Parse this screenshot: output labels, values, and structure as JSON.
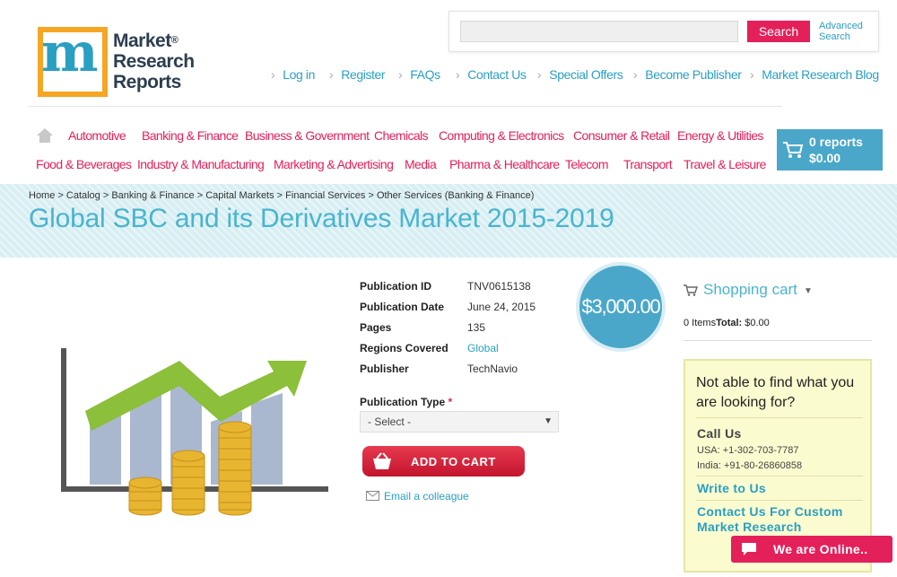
{
  "header": {
    "logo": {
      "line1": "Market",
      "line2": "Research",
      "line3": "Reports",
      "mark": "®"
    },
    "search": {
      "placeholder": "",
      "button_label": "Search",
      "advanced_line1": "Advanced",
      "advanced_line2": "Search"
    },
    "top_links": [
      "Log in",
      "Register",
      "FAQs",
      "Contact Us",
      "Special Offers",
      "Become Publisher",
      "Market Research Blog"
    ]
  },
  "nav": {
    "row1": [
      "Automotive",
      "Banking & Finance",
      "Business & Government",
      "Chemicals",
      "Computing & Electronics",
      "Consumer & Retail",
      "Energy & Utilities"
    ],
    "row2": [
      "Food & Beverages",
      "Industry & Manufacturing",
      "Marketing & Advertising",
      "Media",
      "Pharma & Healthcare",
      "Telecom",
      "Transport",
      "Travel & Leisure"
    ]
  },
  "cart_summary": {
    "reports": "0 reports",
    "total": "$0.00"
  },
  "breadcrumb": "Home > Catalog > Banking & Finance > Capital Markets > Financial Services > Other Services (Banking & Finance)",
  "page_title": "Global SBC and its Derivatives Market 2015-2019",
  "product": {
    "details": [
      {
        "label": "Publication ID",
        "value": "TNV0615138"
      },
      {
        "label": "Publication Date",
        "value": "June 24, 2015"
      },
      {
        "label": "Pages",
        "value": "135"
      },
      {
        "label": "Regions Covered",
        "value": "Global"
      },
      {
        "label": "Publisher",
        "value": "TechNavio"
      }
    ],
    "price": "$3,000.00",
    "publication_type_label": "Publication Type",
    "required_mark": "*",
    "publication_type_selected": "- Select -",
    "add_to_cart_label": "ADD TO CART",
    "email_colleague_label": "Email a colleague"
  },
  "sidebar": {
    "shopping_cart_title": "Shopping cart",
    "items_label": "0 Items",
    "total_label": "Total:",
    "total_value": "$0.00",
    "help": {
      "question": "Not able to find what you are looking for?",
      "call_us": "Call Us",
      "usa_phone": "USA: +1-302-703-7787",
      "india_phone": "India: +91-80-26860858",
      "write_to_us": "Write to Us",
      "custom_research": "Contact Us For Custom Market Research"
    }
  },
  "chat": {
    "label": "We are Online.."
  },
  "colors": {
    "accent_pink": "#e4205b",
    "accent_blue": "#4aa7c9",
    "title_blue": "#4ab4cf",
    "link_blue": "#2a9fc2"
  }
}
